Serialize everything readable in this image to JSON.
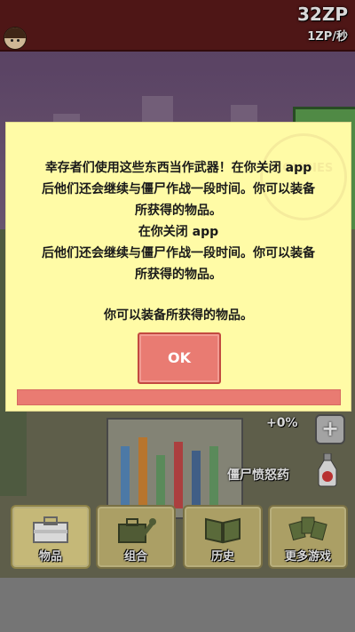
{
  "header": {
    "zp_total": "32ZP",
    "zp_rate": "1ZP/秒"
  },
  "scene": {
    "bonus_label": "+0%",
    "bonus_button_symbol": "+",
    "potion_label": "僵尸愤怒药"
  },
  "dialog": {
    "lines": [
      "幸存者们使用这些东西当作武器！在你关闭 app",
      "后他们还会继续与僵尸作战一段时间。你可以装备",
      "所获得的物品。",
      "在你关闭 app",
      "后他们还会继续与僵尸作战一段时间。你可以装备",
      "所获得的物品。",
      "你可以装备所获得的物品。"
    ],
    "watermark": "ZOMBIES",
    "ok_label": "OK",
    "progress": 1.0
  },
  "menu": {
    "items": [
      {
        "label": "物品",
        "icon": "toolbox-icon",
        "active": true
      },
      {
        "label": "组合",
        "icon": "wrench-bag-icon",
        "active": false
      },
      {
        "label": "历史",
        "icon": "book-icon",
        "active": false
      },
      {
        "label": "更多游戏",
        "icon": "cards-icon",
        "active": false
      }
    ]
  },
  "colors": {
    "dialog_bg": "#fffba6",
    "ok_button": "#e97b72",
    "top_bar": "#5c1a1a",
    "menu_button": "#c9bb77"
  }
}
